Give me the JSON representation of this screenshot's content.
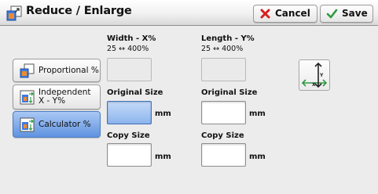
{
  "header": {
    "title": "Reduce / Enlarge",
    "cancel_label": "Cancel",
    "save_label": "Save"
  },
  "modes": [
    {
      "label": "Proportional %",
      "selected": false
    },
    {
      "label": "Independent X - Y%",
      "selected": false
    },
    {
      "label": "Calculator %",
      "selected": true
    }
  ],
  "width_column": {
    "heading": "Width - X%",
    "range": "25 ↔ 400%",
    "original_size_label": "Original Size",
    "copy_size_label": "Copy Size",
    "unit": "mm"
  },
  "length_column": {
    "heading": "Length - Y%",
    "range": "25 ↔ 400%",
    "original_size_label": "Original Size",
    "copy_size_label": "Copy Size",
    "unit": "mm"
  },
  "diagram": {
    "x_label": "X",
    "y_label": "Y"
  },
  "colors": {
    "selected_fill": "#6f9fe6",
    "accent_green": "#2e9b3e",
    "cancel_red": "#d62020"
  }
}
